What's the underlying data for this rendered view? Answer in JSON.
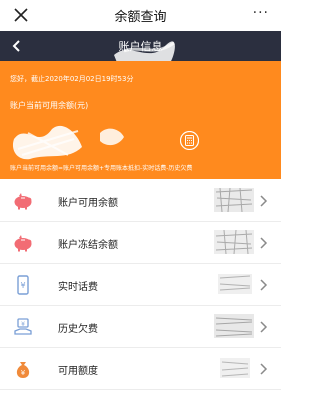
{
  "app": {
    "title": "余额查询",
    "more_label": "···"
  },
  "nav": {
    "title": "账户信息"
  },
  "summary": {
    "greeting": "您好，截止2020年02月02日19时53分",
    "available_label": "账户当前可用余额(元)",
    "formula": "账户当前可用余额=账户可用余额+专用账本抵扣-实时话费-历史欠费"
  },
  "colors": {
    "orange": "#ff8a1e",
    "navbar": "#2b2f3f",
    "pig": "#f26c74",
    "blue_icon": "#7a9fd6",
    "bag": "#f08a3a"
  },
  "list": [
    {
      "label": "账户可用余额",
      "icon": "piggy-bank-icon"
    },
    {
      "label": "账户冻结余额",
      "icon": "piggy-bank-icon"
    },
    {
      "label": "实时话费",
      "icon": "phone-yuan-icon"
    },
    {
      "label": "历史欠费",
      "icon": "hand-coin-icon"
    },
    {
      "label": "可用额度",
      "icon": "money-bag-icon"
    }
  ]
}
